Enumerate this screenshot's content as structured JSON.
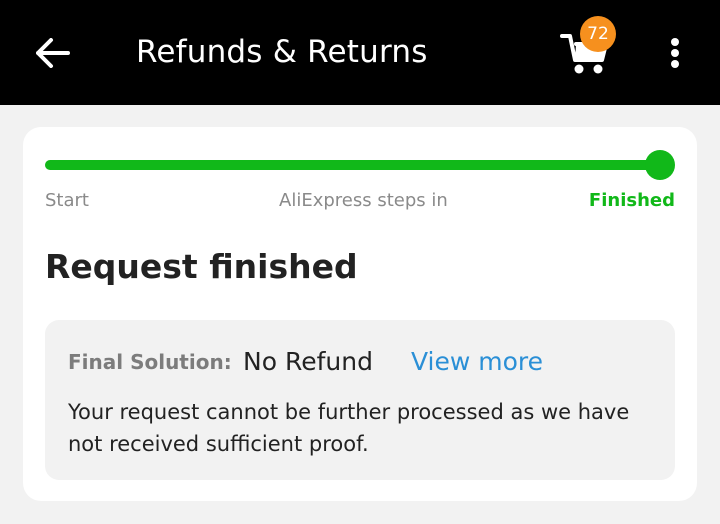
{
  "header": {
    "title": "Refunds & Returns",
    "cart_count": "72",
    "icons": {
      "back": "arrow-left-icon",
      "cart": "cart-icon",
      "more": "more-vertical-icon"
    }
  },
  "progress": {
    "fraction": 1.0,
    "steps": [
      "Start",
      "AliExpress steps in",
      "Finished"
    ],
    "active_color": "#11b819"
  },
  "request": {
    "heading": "Request finished",
    "solution_label": "Final Solution:",
    "solution_value": "No Refund",
    "view_more": "View more",
    "description": "Your request cannot be further processed as we have not received sufficient proof."
  }
}
